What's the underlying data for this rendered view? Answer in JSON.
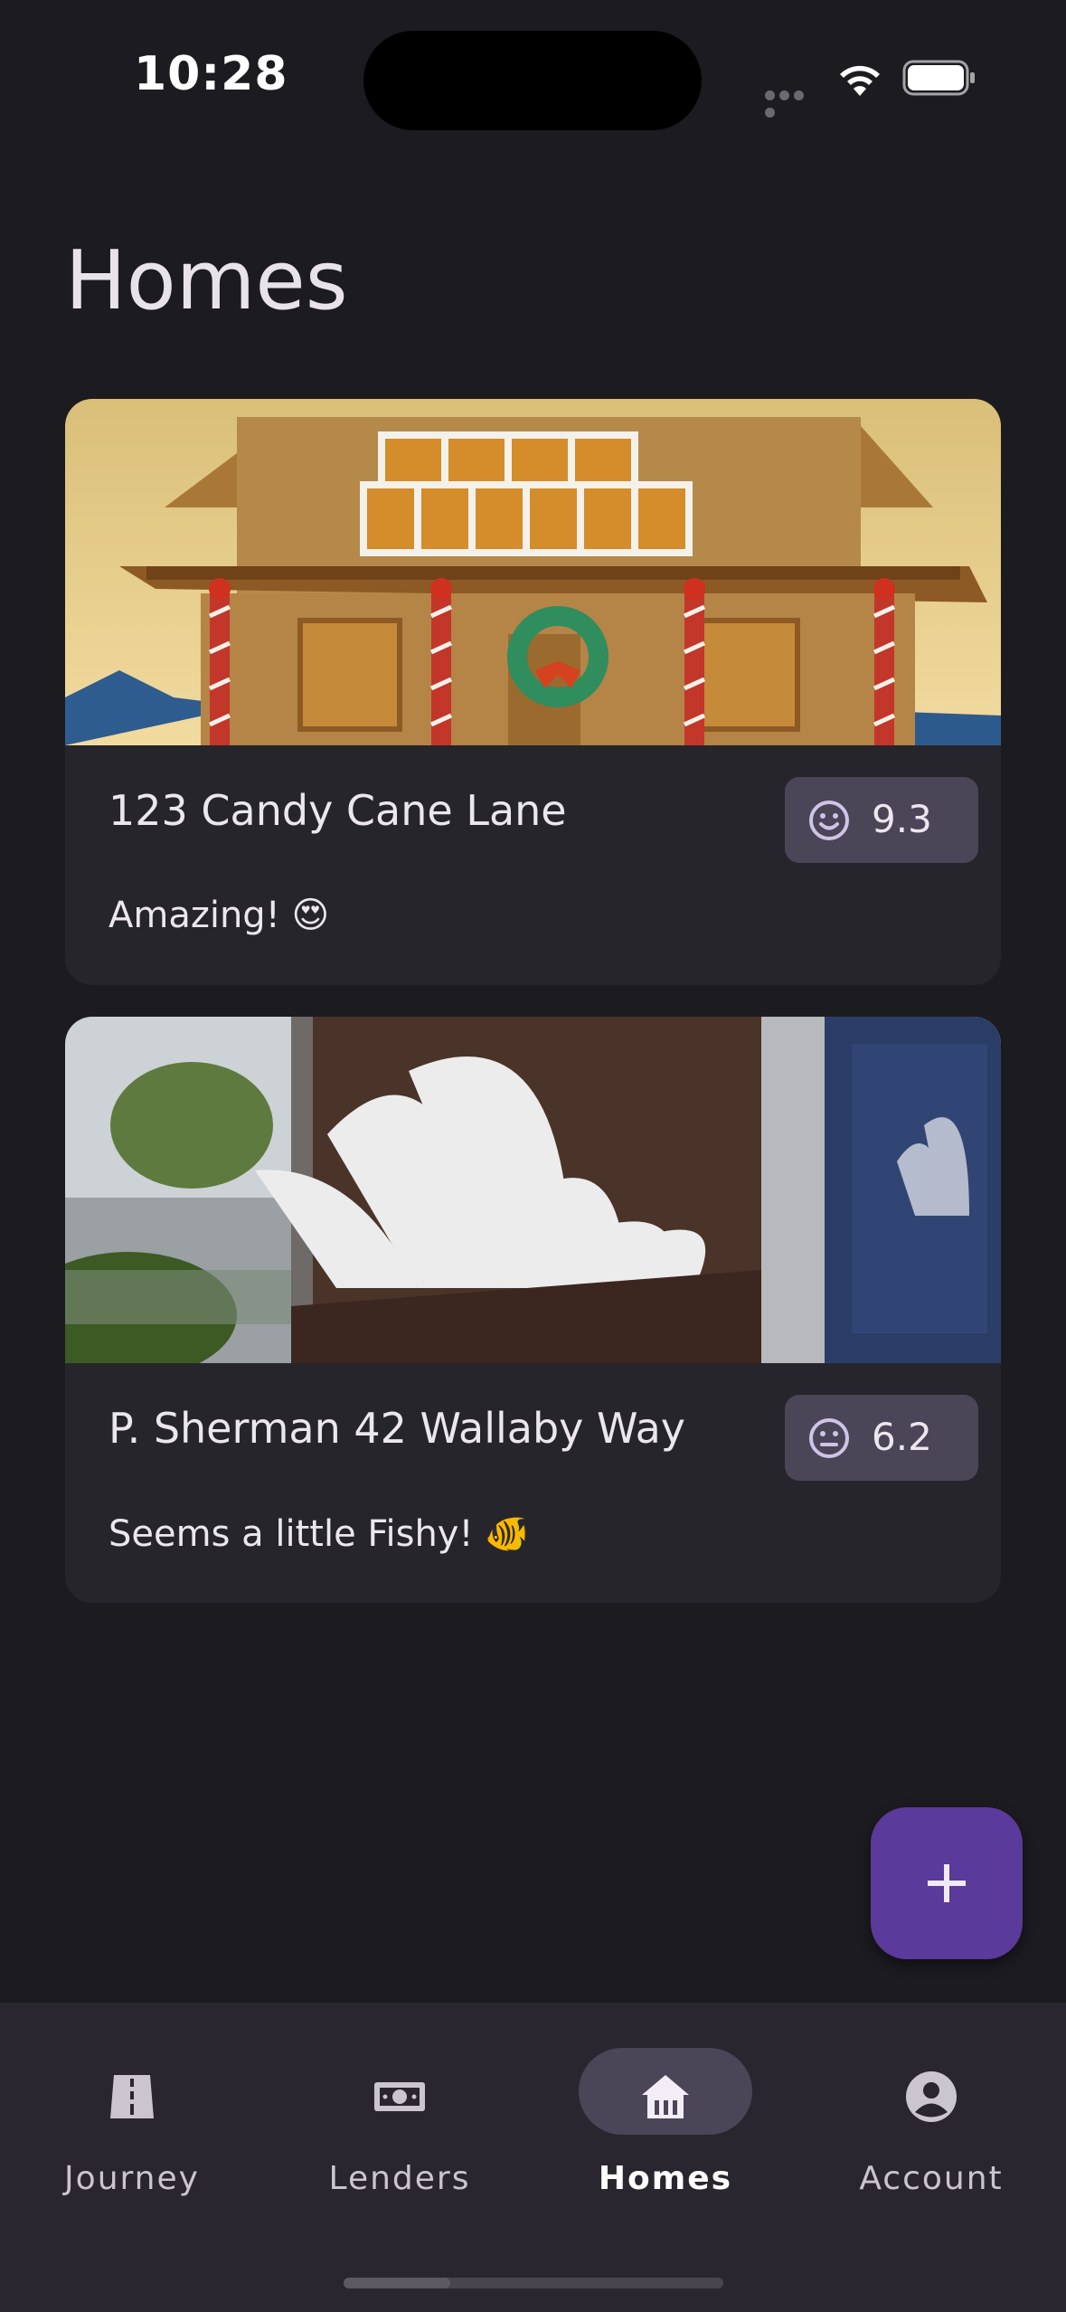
{
  "status_bar": {
    "time": "10:28"
  },
  "page": {
    "title": "Homes"
  },
  "homes": [
    {
      "address": "123 Candy Cane Lane",
      "description": "Amazing! 😍",
      "score": "9.3",
      "score_icon": "smiley-icon",
      "image_subject": "gingerbread-house"
    },
    {
      "address": "P. Sherman 42 Wallaby Way",
      "description": "Seems a little Fishy! 🐠",
      "score": "6.2",
      "score_icon": "neutral-face-icon",
      "image_subject": "dentist-office-window"
    }
  ],
  "fab": {
    "icon": "plus-icon"
  },
  "bottom_nav": {
    "items": [
      {
        "label": "Journey",
        "icon": "road-icon",
        "active": false
      },
      {
        "label": "Lenders",
        "icon": "cash-icon",
        "active": false
      },
      {
        "label": "Homes",
        "icon": "house-icon",
        "active": true
      },
      {
        "label": "Account",
        "icon": "account-circle-icon",
        "active": false
      }
    ]
  },
  "colors": {
    "background": "#1c1b20",
    "card": "#27252c",
    "chip": "#4a4557",
    "fab": "#5a3a9a",
    "nav_bar": "#29262f"
  }
}
